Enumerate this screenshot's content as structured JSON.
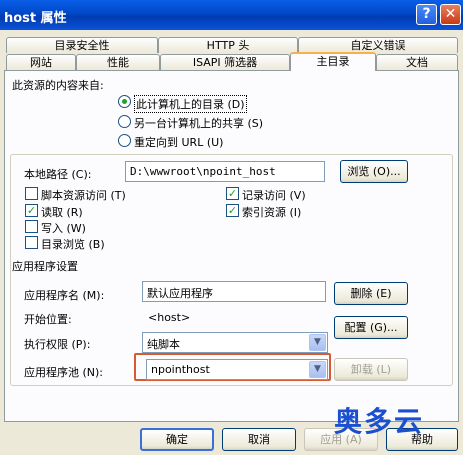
{
  "window": {
    "title": "host 属性",
    "help_glyph": "?",
    "close_glyph": "✕"
  },
  "tabs": {
    "row1": [
      "目录安全性",
      "HTTP 头",
      "自定义错误"
    ],
    "row2": [
      "网站",
      "性能",
      "ISAPI 筛选器",
      "主目录",
      "文档"
    ],
    "active": "主目录"
  },
  "source": {
    "label": "此资源的内容来自:",
    "options": [
      {
        "label": "此计算机上的目录 (D)",
        "selected": true
      },
      {
        "label": "另一台计算机上的共享 (S)",
        "selected": false
      },
      {
        "label": "重定向到 URL (U)",
        "selected": false
      }
    ]
  },
  "path": {
    "label": "本地路径 (C):",
    "value": "D:\\wwwroot\\npoint_host",
    "browse_label": "浏览 (O)..."
  },
  "permissions": [
    {
      "label": "脚本资源访问 (T)",
      "checked": false
    },
    {
      "label": "记录访问 (V)",
      "checked": true
    },
    {
      "label": "读取 (R)",
      "checked": true
    },
    {
      "label": "索引资源 (I)",
      "checked": true
    },
    {
      "label": "写入 (W)",
      "checked": false
    },
    {
      "label": "目录浏览 (B)",
      "checked": false
    }
  ],
  "app": {
    "section_label": "应用程序设置",
    "name_label": "应用程序名 (M):",
    "name_value": "默认应用程序",
    "remove_label": "删除 (E)",
    "start_label": "开始位置:",
    "start_value": "<host>",
    "config_label": "配置 (G)...",
    "exec_label": "执行权限 (P):",
    "exec_value": "纯脚本",
    "pool_label": "应用程序池 (N):",
    "pool_value": "npointhost",
    "unload_label": "卸载 (L)"
  },
  "buttons": {
    "ok": "确定",
    "cancel": "取消",
    "apply": "应用 (A)",
    "help": "帮助"
  },
  "watermark": "奥多云"
}
